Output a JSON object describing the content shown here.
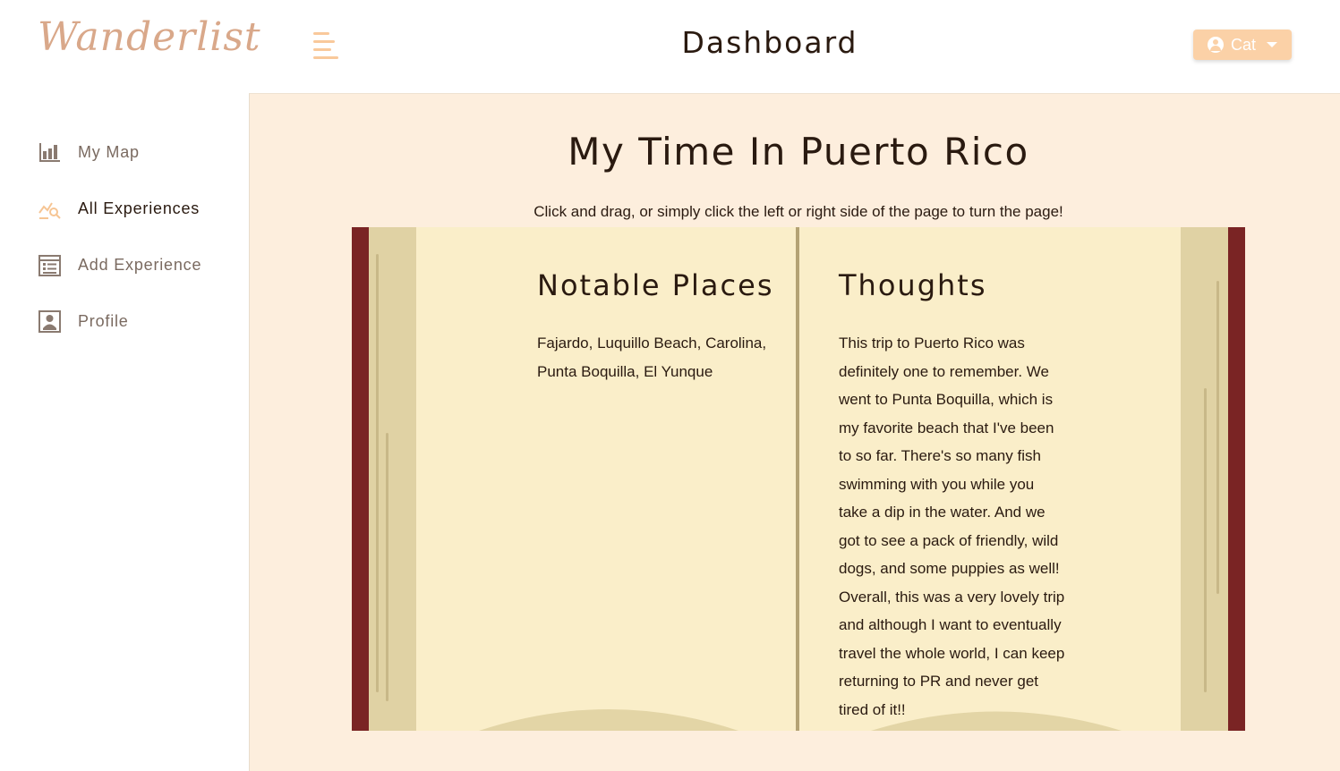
{
  "app": {
    "logo": "Wanderlist",
    "title": "Dashboard",
    "user_label": "Cat",
    "accent_color": "#fbd1a7",
    "cover_color": "#7a2424"
  },
  "sidebar": {
    "items": [
      {
        "label": "My Map",
        "icon": "bar-chart-icon"
      },
      {
        "label": "All Experiences",
        "icon": "chart-search-icon"
      },
      {
        "label": "Add Experience",
        "icon": "newspaper-icon"
      },
      {
        "label": "Profile",
        "icon": "profile-icon"
      }
    ]
  },
  "main": {
    "book_title": "My Time In Puerto Rico",
    "hint": "Click and drag, or simply click the left or right side of the page to turn the page!",
    "left_page": {
      "heading": "Notable Places",
      "body": "Fajardo, Luquillo Beach, Carolina, Punta Boquilla, El Yunque"
    },
    "right_page": {
      "heading": "Thoughts",
      "body": "This trip to Puerto Rico was definitely one to remember. We went to Punta Boquilla, which is my favorite beach that I've been to so far. There's so many fish swimming with you while you take a dip in the water. And we got to see a pack of friendly, wild dogs, and some puppies as well! Overall, this was a very lovely trip and although I want to eventually travel the whole world, I can keep returning to PR and never get tired of it!!"
    }
  }
}
